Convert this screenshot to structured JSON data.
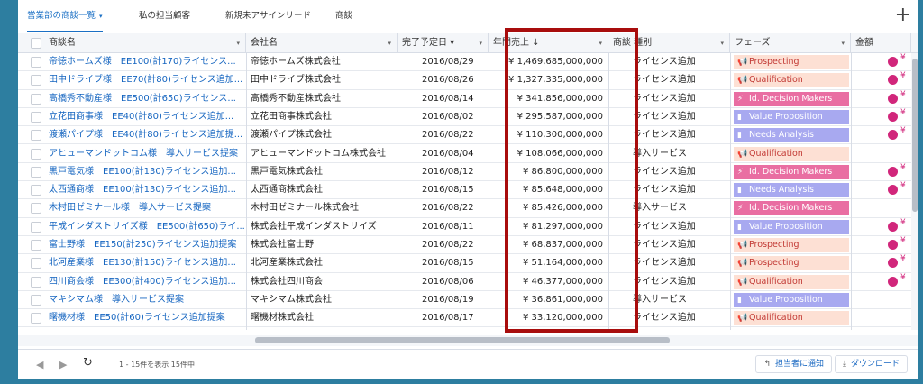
{
  "tabs": [
    {
      "label": "営業部の商談一覧",
      "active": true,
      "caret": "▾"
    },
    {
      "label": "私の担当顧客",
      "active": false
    },
    {
      "label": "新規未アサインリード",
      "active": false
    },
    {
      "label": "商談",
      "active": false
    }
  ],
  "add_icon": "+",
  "columns": [
    {
      "label": "商談名",
      "dd": "▾"
    },
    {
      "label": "会社名",
      "dd": "▾"
    },
    {
      "label": "完了予定日 ▾",
      "dd": "▾"
    },
    {
      "label": "年間売上 ↓",
      "dd": "▾"
    },
    {
      "label": "商談 種別",
      "dd": "▾"
    },
    {
      "label": "フェーズ",
      "dd": "▾"
    },
    {
      "label": "金額",
      "dd": ""
    }
  ],
  "rows": [
    {
      "name": "帝徳ホームズ様　EE100(計170)ライセンス...",
      "company": "帝徳ホームズ株式会社",
      "date": "2016/08/29",
      "revenue": "¥ 1,469,685,000,000",
      "type": "ライセンス追加",
      "phase": "Prospecting",
      "phase_class": "ph-prospect",
      "phase_icon": "📢",
      "amount": "¥"
    },
    {
      "name": "田中ドライブ様　EE70(計80)ライセンス追加...",
      "company": "田中ドライブ株式会社",
      "date": "2016/08/26",
      "revenue": "¥ 1,327,335,000,000",
      "type": "ライセンス追加",
      "phase": "Qualification",
      "phase_class": "ph-qual",
      "phase_icon": "📢",
      "amount": "¥"
    },
    {
      "name": "高橋秀不動産様　EE500(計650)ライセンス...",
      "company": "高橋秀不動産株式会社",
      "date": "2016/08/14",
      "revenue": "¥ 341,856,000,000",
      "type": "ライセンス追加",
      "phase": "Id. Decision Makers",
      "phase_class": "ph-idd",
      "phase_icon": "⚡",
      "amount": "¥"
    },
    {
      "name": "立花田商事様　EE40(計80)ライセンス追加...",
      "company": "立花田商事株式会社",
      "date": "2016/08/02",
      "revenue": "¥ 295,587,000,000",
      "type": "ライセンス追加",
      "phase": "Value Proposition",
      "phase_class": "ph-vp",
      "phase_icon": "▮",
      "amount": "¥"
    },
    {
      "name": "渡瀬パイプ様　EE40(計80)ライセンス追加提...",
      "company": "渡瀬パイプ株式会社",
      "date": "2016/08/22",
      "revenue": "¥ 110,300,000,000",
      "type": "ライセンス追加",
      "phase": "Needs Analysis",
      "phase_class": "ph-na",
      "phase_icon": "▮",
      "amount": "¥"
    },
    {
      "name": "アヒューマンドットコム様　導入サービス提案",
      "company": "アヒューマンドットコム株式会社",
      "date": "2016/08/04",
      "revenue": "¥ 108,066,000,000",
      "type": "導入サービス",
      "phase": "Qualification",
      "phase_class": "ph-qual",
      "phase_icon": "📢",
      "amount": ""
    },
    {
      "name": "黒戸電気様　EE100(計130)ライセンス追加...",
      "company": "黒戸電気株式会社",
      "date": "2016/08/12",
      "revenue": "¥ 86,800,000,000",
      "type": "ライセンス追加",
      "phase": "Id. Decision Makers",
      "phase_class": "ph-idd",
      "phase_icon": "⚡",
      "amount": "¥"
    },
    {
      "name": "太西通商様　EE100(計130)ライセンス追加...",
      "company": "太西通商株式会社",
      "date": "2016/08/15",
      "revenue": "¥ 85,648,000,000",
      "type": "ライセンス追加",
      "phase": "Needs Analysis",
      "phase_class": "ph-na",
      "phase_icon": "▮",
      "amount": "¥"
    },
    {
      "name": "木村田ゼミナール様　導入サービス提案",
      "company": "木村田ゼミナール株式会社",
      "date": "2016/08/22",
      "revenue": "¥ 85,426,000,000",
      "type": "導入サービス",
      "phase": "Id. Decision Makers",
      "phase_class": "ph-idd",
      "phase_icon": "⚡",
      "amount": ""
    },
    {
      "name": "平成インダストリイズ様　EE500(計650)ライ...",
      "company": "株式会社平成インダストリイズ",
      "date": "2016/08/11",
      "revenue": "¥ 81,297,000,000",
      "type": "ライセンス追加",
      "phase": "Value Proposition",
      "phase_class": "ph-vp",
      "phase_icon": "▮",
      "amount": "¥"
    },
    {
      "name": "富士野様　EE150(計250)ライセンス追加提案",
      "company": "株式会社富士野",
      "date": "2016/08/22",
      "revenue": "¥ 68,837,000,000",
      "type": "ライセンス追加",
      "phase": "Prospecting",
      "phase_class": "ph-prospect",
      "phase_icon": "📢",
      "amount": "¥"
    },
    {
      "name": "北河産業様　EE130(計150)ライセンス追加...",
      "company": "北河産業株式会社",
      "date": "2016/08/15",
      "revenue": "¥ 51,164,000,000",
      "type": "ライセンス追加",
      "phase": "Prospecting",
      "phase_class": "ph-prospect",
      "phase_icon": "📢",
      "amount": "¥"
    },
    {
      "name": "四川商会様　EE300(計400)ライセンス追加...",
      "company": "株式会社四川商会",
      "date": "2016/08/06",
      "revenue": "¥ 46,377,000,000",
      "type": "ライセンス追加",
      "phase": "Qualification",
      "phase_class": "ph-qual",
      "phase_icon": "📢",
      "amount": "¥"
    },
    {
      "name": "マキシマム様　導入サービス提案",
      "company": "マキシマム株式会社",
      "date": "2016/08/19",
      "revenue": "¥ 36,861,000,000",
      "type": "導入サービス",
      "phase": "Value Proposition",
      "phase_class": "ph-vp",
      "phase_icon": "▮",
      "amount": ""
    },
    {
      "name": "曙機材様　EE50(計60)ライセンス追加提案",
      "company": "曙機材株式会社",
      "date": "2016/08/17",
      "revenue": "¥ 33,120,000,000",
      "type": "ライセンス追加",
      "phase": "Qualification",
      "phase_class": "ph-qual",
      "phase_icon": "📢",
      "amount": ""
    }
  ],
  "footer": {
    "prev": "◀",
    "next": "▶",
    "refresh": "↻",
    "info": "1 - 15件を表示 15件中",
    "notify_label": "担当者に通知",
    "notify_icon": "↰",
    "download_label": "ダウンロード",
    "download_icon": "⤓"
  }
}
